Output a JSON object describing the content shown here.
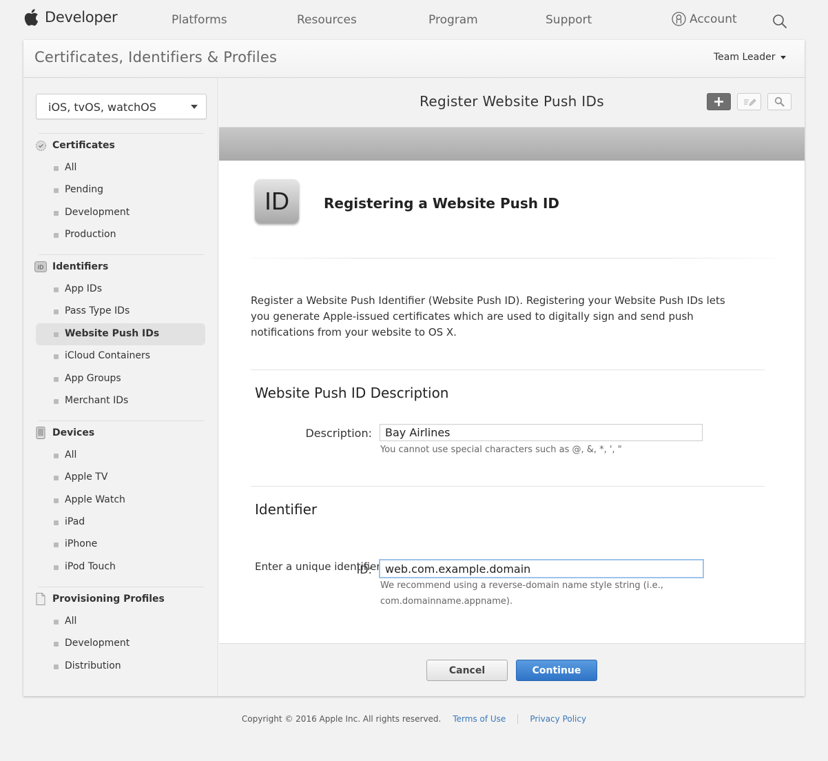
{
  "nav": {
    "brand": "Developer",
    "links": [
      "Platforms",
      "Resources",
      "Program",
      "Support"
    ],
    "account": "Account",
    "icons": {
      "logo": "apple-logo-icon",
      "account": "account-icon",
      "search": "search-icon"
    }
  },
  "header": {
    "title": "Certificates, Identifiers & Profiles",
    "team": "Team Leader"
  },
  "sidebar": {
    "platform": "iOS, tvOS, watchOS",
    "sections": [
      {
        "label": "Certificates",
        "icon": "certificate-icon",
        "items": [
          "All",
          "Pending",
          "Development",
          "Production"
        ]
      },
      {
        "label": "Identifiers",
        "icon": "id-icon",
        "items": [
          "App IDs",
          "Pass Type IDs",
          "Website Push IDs",
          "iCloud Containers",
          "App Groups",
          "Merchant IDs"
        ]
      },
      {
        "label": "Devices",
        "icon": "device-icon",
        "items": [
          "All",
          "Apple TV",
          "Apple Watch",
          "iPad",
          "iPhone",
          "iPod Touch"
        ]
      },
      {
        "label": "Provisioning Profiles",
        "icon": "document-icon",
        "items": [
          "All",
          "Development",
          "Distribution"
        ]
      }
    ],
    "active": "Website Push IDs"
  },
  "content": {
    "title": "Register Website Push IDs",
    "toolbar_icons": [
      "add-icon",
      "edit-icon",
      "search-icon"
    ],
    "badge": "ID",
    "heading": "Registering a Website Push ID",
    "intro": "Register a Website Push Identifier (Website Push ID). Registering your Website Push IDs lets you generate Apple-issued certificates which are used to digitally sign and send push notifications from your website to OS X.",
    "description_section": {
      "title": "Website Push ID Description",
      "label": "Description:",
      "value": "Bay Airlines",
      "hint": "You cannot use special characters such as @, &, *, ', \""
    },
    "identifier_section": {
      "title": "Identifier",
      "subtitle": "Enter a unique identifier for your Website Push ID, starting with the string 'web'.",
      "label": "ID:",
      "value": "web.com.example.domain",
      "hint_line1": "We recommend using a reverse-domain name style string (i.e.,",
      "hint_line2": "com.domainname.appname)."
    },
    "buttons": {
      "cancel": "Cancel",
      "continue": "Continue"
    }
  },
  "footer": {
    "copyright": "Copyright © 2016 Apple Inc. All rights reserved.",
    "terms": "Terms of Use",
    "privacy": "Privacy Policy"
  },
  "colors": {
    "accent": "#2f74c7",
    "link": "#3a77b8"
  }
}
